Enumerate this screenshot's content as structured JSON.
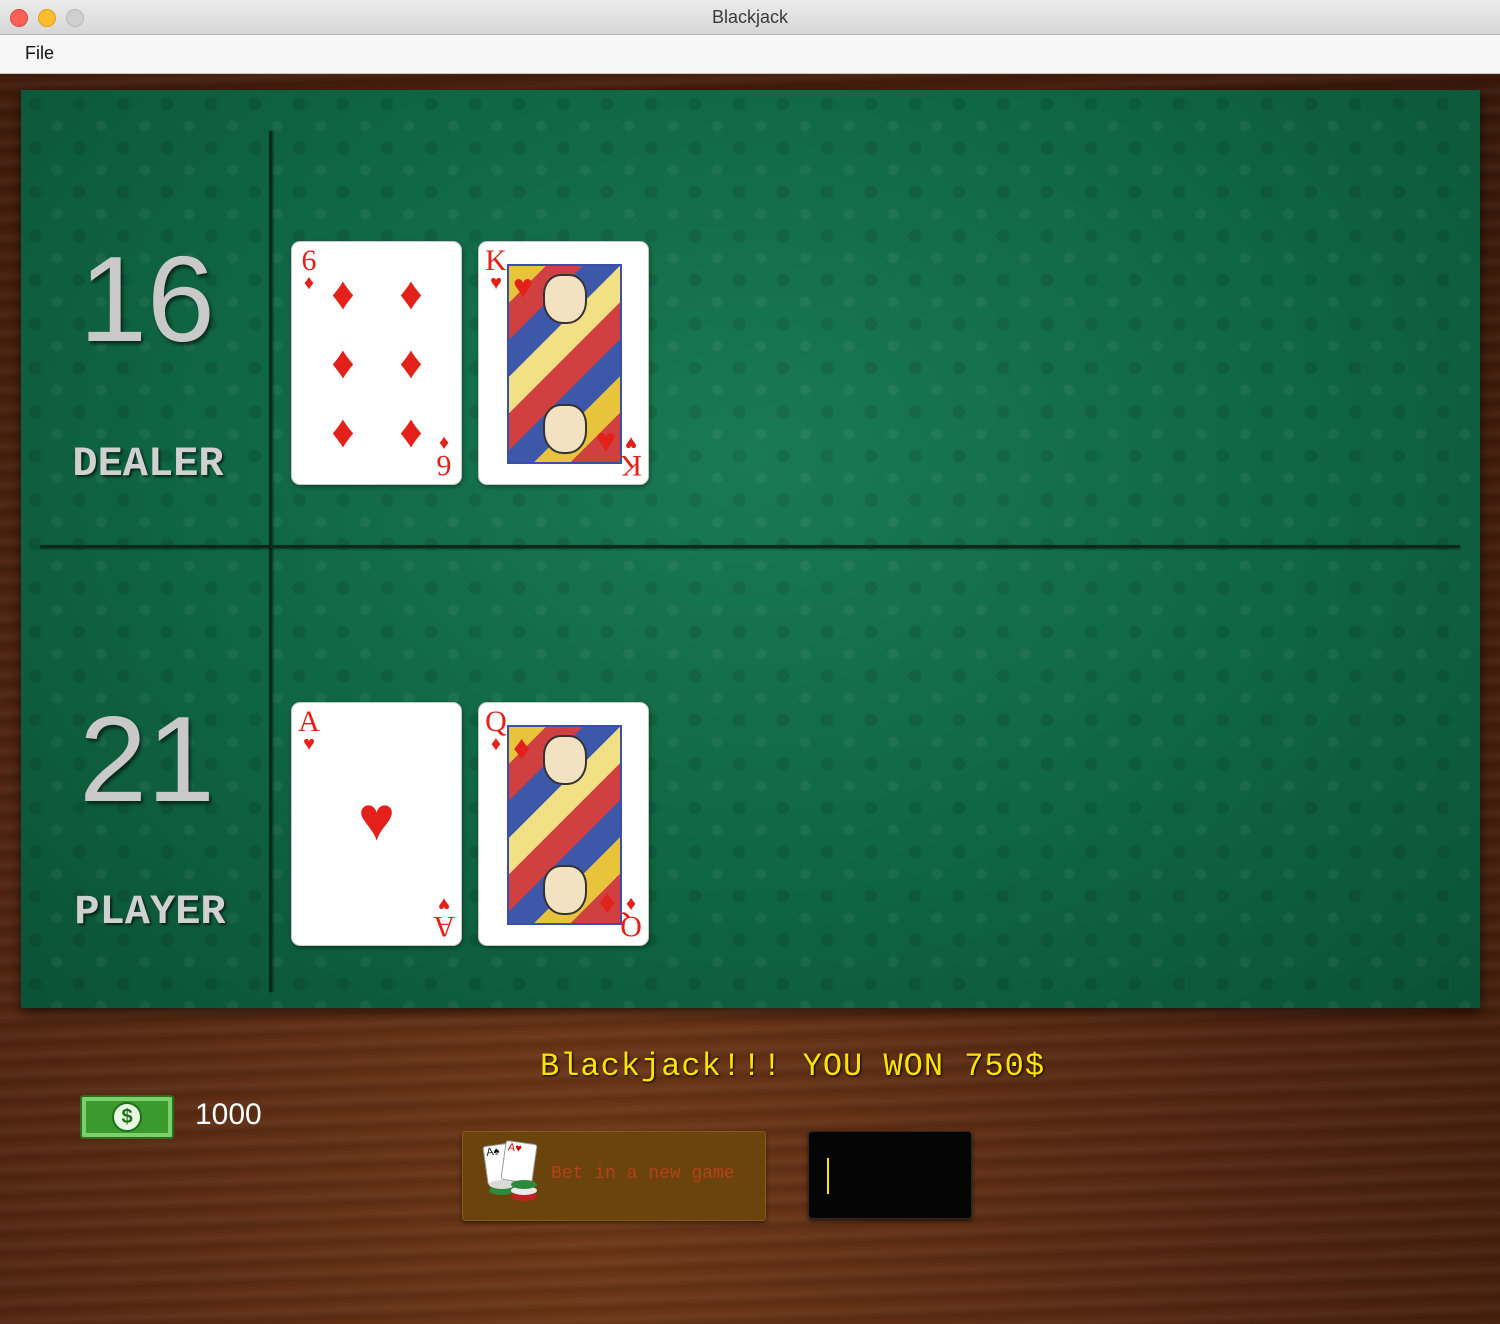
{
  "window": {
    "title": "Blackjack"
  },
  "menu": {
    "file_label": "File"
  },
  "dealer": {
    "score": "16",
    "label": "DEALER",
    "cards": [
      {
        "rank": "6",
        "suit": "♦",
        "suit_name": "diamonds"
      },
      {
        "rank": "K",
        "suit": "♥",
        "suit_name": "hearts"
      }
    ]
  },
  "player": {
    "score": "21",
    "label": "PLAYER",
    "cards": [
      {
        "rank": "A",
        "suit": "♥",
        "suit_name": "hearts"
      },
      {
        "rank": "Q",
        "suit": "♦",
        "suit_name": "diamonds"
      }
    ]
  },
  "status": {
    "message": "Blackjack!!! YOU WON 750$"
  },
  "wallet": {
    "icon": "dollar-bill-icon",
    "balance": "1000"
  },
  "controls": {
    "bet_button_label": "Bet in a new game",
    "bet_input_value": ""
  },
  "colors": {
    "felt": "#0f6544",
    "wood": "#4f2410",
    "card_red": "#e2221a",
    "message": "#ffe300",
    "button": "#6b430c"
  }
}
